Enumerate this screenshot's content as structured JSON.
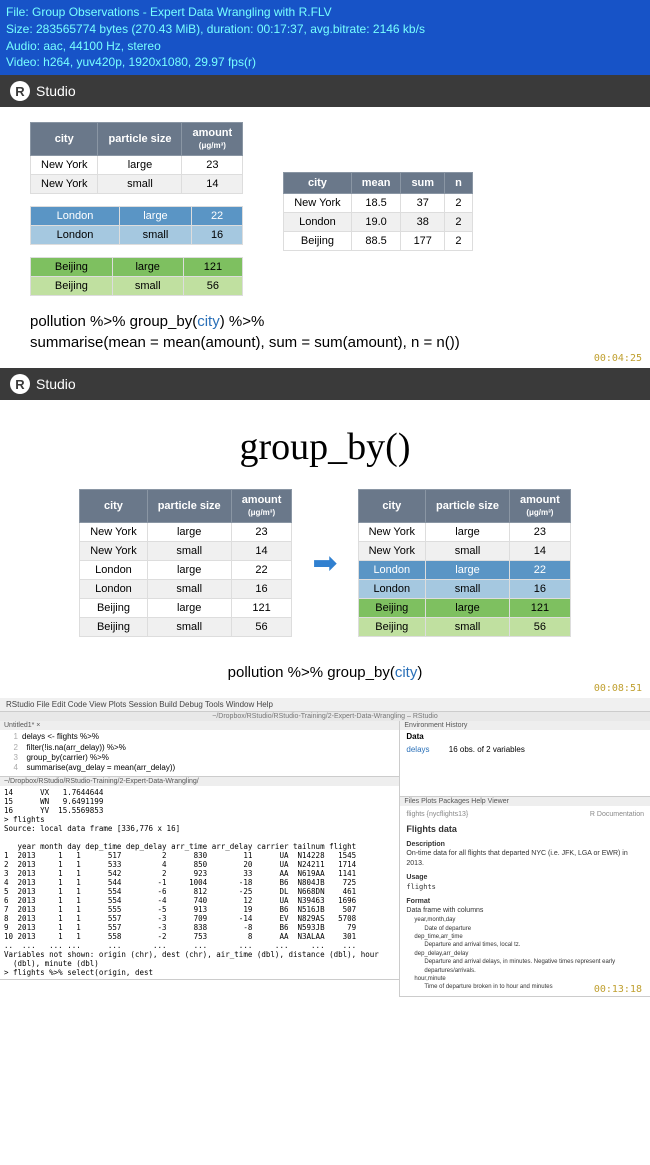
{
  "info": {
    "file": "File: Group Observations - Expert Data Wrangling with R.FLV",
    "size": "Size: 283565774 bytes (270.43 MiB), duration: 00:17:37, avg.bitrate: 2146 kb/s",
    "audio": "Audio: aac, 44100 Hz, stereo",
    "video": "Video: h264, yuv420p, 1920x1080, 29.97 fps(r)"
  },
  "rstudio_label": "Studio",
  "slide1": {
    "th": {
      "city": "city",
      "size": "particle size",
      "amount": "amount",
      "unit": "(μg/m³)"
    },
    "nyc": [
      [
        "New York",
        "large",
        "23"
      ],
      [
        "New York",
        "small",
        "14"
      ]
    ],
    "lon": [
      [
        "London",
        "large",
        "22"
      ],
      [
        "London",
        "small",
        "16"
      ]
    ],
    "bei": [
      [
        "Beijing",
        "large",
        "121"
      ],
      [
        "Beijing",
        "small",
        "56"
      ]
    ],
    "summary_th": {
      "city": "city",
      "mean": "mean",
      "sum": "sum",
      "n": "n"
    },
    "summary": [
      [
        "New York",
        "18.5",
        "37",
        "2"
      ],
      [
        "London",
        "19.0",
        "38",
        "2"
      ],
      [
        "Beijing",
        "88.5",
        "177",
        "2"
      ]
    ],
    "code1a": "pollution %>% group_by(",
    "code1b": "city",
    "code1c": ") %>%",
    "code2a": "    summarise(mean = mean(amount), sum = sum(amount), n = n())",
    "ts": "00:04:25"
  },
  "slide2": {
    "title": "group_by()",
    "th": {
      "city": "city",
      "size": "particle size",
      "amount": "amount",
      "unit": "(μg/m³)"
    },
    "left": [
      [
        "New York",
        "large",
        "23"
      ],
      [
        "New York",
        "small",
        "14"
      ],
      [
        "London",
        "large",
        "22"
      ],
      [
        "London",
        "small",
        "16"
      ],
      [
        "Beijing",
        "large",
        "121"
      ],
      [
        "Beijing",
        "small",
        "56"
      ]
    ],
    "right": [
      [
        "New York",
        "large",
        "23"
      ],
      [
        "New York",
        "small",
        "14"
      ],
      [
        "London",
        "large",
        "22"
      ],
      [
        "London",
        "small",
        "16"
      ],
      [
        "Beijing",
        "large",
        "121"
      ],
      [
        "Beijing",
        "small",
        "56"
      ]
    ],
    "code_a": "pollution %>% group_by(",
    "code_b": "city",
    "code_c": ")",
    "ts": "00:08:51"
  },
  "ide": {
    "menu": "RStudio   File   Edit   Code   View   Plots   Session   Build   Debug   Tools   Window   Help",
    "title": "~/Dropbox/RStudio/RStudio-Training/2-Expert-Data-Wrangling – RStudio",
    "src_tab": "Untitled1* ×",
    "src_lines": [
      "delays <- flights %>%",
      "  filter(!is.na(arr_delay)) %>%",
      "  group_by(carrier) %>%",
      "  summarise(avg_delay = mean(arr_delay))"
    ],
    "console_path": "~/Dropbox/RStudio/RStudio-Training/2-Expert-Data-Wrangling/",
    "console": "14      VX   1.7644644\n15      WN   9.6491199\n16      YV  15.5569853\n> flights\nSource: local data frame [336,776 x 16]\n\n   year month day dep_time dep_delay arr_time arr_delay carrier tailnum flight\n1  2013     1   1      517         2      830        11      UA  N14228   1545\n2  2013     1   1      533         4      850        20      UA  N24211   1714\n3  2013     1   1      542         2      923        33      AA  N619AA   1141\n4  2013     1   1      544        -1     1004       -18      B6  N804JB    725\n5  2013     1   1      554        -6      812       -25      DL  N668DN    461\n6  2013     1   1      554        -4      740        12      UA  N39463   1696\n7  2013     1   1      555        -5      913        19      B6  N516JB    507\n8  2013     1   1      557        -3      709       -14      EV  N829AS   5708\n9  2013     1   1      557        -3      838        -8      B6  N593JB     79\n10 2013     1   1      558        -2      753         8      AA  N3ALAA    301\n..  ...   ... ...      ...       ...      ...       ...     ...     ...    ...\nVariables not shown: origin (chr), dest (chr), air_time (dbl), distance (dbl), hour\n  (dbl), minute (dbl)\n> flights %>% select(origin, dest",
    "env_tab": "Environment   History",
    "env_header": "Data",
    "env_row_name": "delays",
    "env_row_val": "16 obs. of 2 variables",
    "help_tabs": "Files   Plots   Packages   Help   Viewer",
    "help_topic": "flights {nycflights13}",
    "help_doc": "R Documentation",
    "help_title": "Flights data",
    "help_desc_h": "Description",
    "help_desc": "On-time data for all flights that departed NYC (i.e. JFK, LGA or EWR) in 2013.",
    "help_usage_h": "Usage",
    "help_usage": "flights",
    "help_format_h": "Format",
    "help_format": "Data frame with columns",
    "help_f1": "year,month,day",
    "help_f1v": "Date of departure",
    "help_f2": "dep_time,arr_time",
    "help_f2v": "Departure and arrival times, local tz.",
    "help_f3": "dep_delay,arr_delay",
    "help_f3v": "Departure and arrival delays, in minutes. Negative times represent early departures/arrivals.",
    "help_f4": "hour,minute",
    "help_f4v": "Time of departure broken in to hour and minutes",
    "ts": "00:13:18"
  }
}
